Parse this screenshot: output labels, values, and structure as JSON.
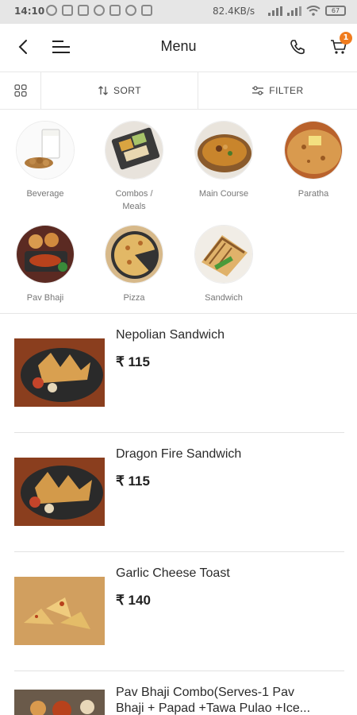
{
  "status_bar": {
    "time": "14:10",
    "speed": "82.4KB/s",
    "battery": "67"
  },
  "header": {
    "title": "Menu",
    "cart_count": "1",
    "icons": [
      "back-arrow-icon",
      "menu-lines-icon",
      "phone-icon",
      "cart-icon"
    ]
  },
  "toolbar": {
    "sort_label": "SORT",
    "filter_label": "FILTER"
  },
  "categories": [
    {
      "label": "Beverage"
    },
    {
      "label": "Combos /"
    },
    {
      "label": "Meals"
    },
    {
      "label": "Main Course"
    },
    {
      "label": "Paratha"
    },
    {
      "label": "Pav Bhaji"
    },
    {
      "label": "Pizza"
    },
    {
      "label": "Sandwich"
    }
  ],
  "items": [
    {
      "name": "Nepolian Sandwich",
      "price": "₹ 115"
    },
    {
      "name": "Dragon Fire Sandwich",
      "price": "₹ 115"
    },
    {
      "name": "Garlic Cheese Toast",
      "price": "₹ 140"
    },
    {
      "name": "Pav Bhaji Combo(Serves-1 Pav",
      "name_line2": "Bhaji + Papad +Tawa Pulao +Ice..."
    }
  ],
  "colors": {
    "accent": "#f07c1e",
    "status_bar": "#e6e6e6",
    "divider": "#e6e6e6"
  }
}
